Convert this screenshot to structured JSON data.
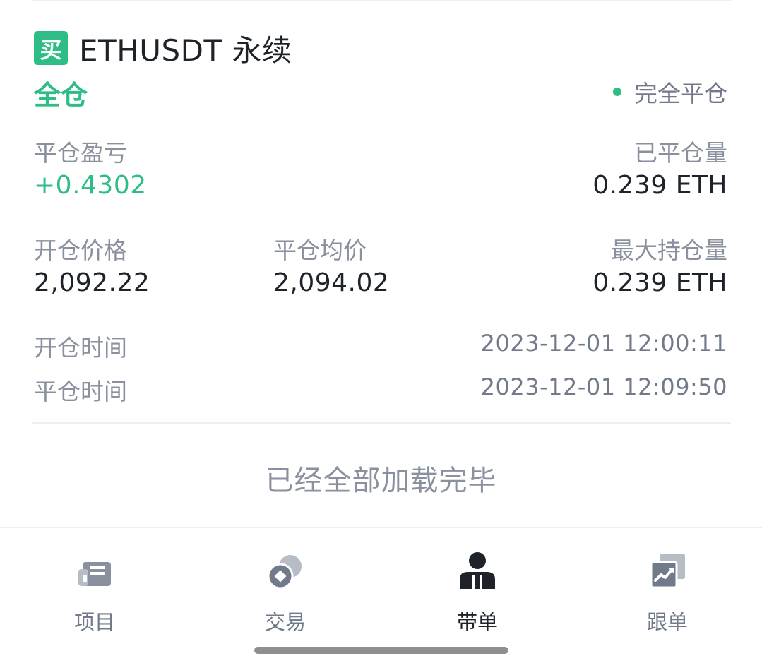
{
  "position": {
    "side_badge": "买",
    "symbol": "ETHUSDT 永续",
    "margin_mode": "全仓",
    "status": "完全平仓",
    "realized_pnl_label": "平仓盈亏",
    "realized_pnl_value": "+0.4302",
    "closed_qty_label": "已平仓量",
    "closed_qty_value": "0.239 ETH",
    "entry_price_label": "开仓价格",
    "entry_price_value": "2,092.22",
    "avg_close_price_label": "平仓均价",
    "avg_close_price_value": "2,094.02",
    "max_position_label": "最大持仓量",
    "max_position_value": "0.239 ETH",
    "open_time_label": "开仓时间",
    "open_time_value": "2023-12-01 12:00:11",
    "close_time_label": "平仓时间",
    "close_time_value": "2023-12-01 12:09:50"
  },
  "list_footer": "已经全部加载完毕",
  "tabbar": {
    "items": [
      {
        "label": "项目",
        "icon": "project-icon"
      },
      {
        "label": "交易",
        "icon": "trade-icon"
      },
      {
        "label": "带单",
        "icon": "lead-trader-icon",
        "active": true
      },
      {
        "label": "跟单",
        "icon": "copy-trade-icon"
      }
    ]
  },
  "colors": {
    "buy_green": "#2ebd85",
    "text_primary": "#1e2329",
    "text_secondary": "#8a919e",
    "icon_gray": "#707a8a"
  }
}
